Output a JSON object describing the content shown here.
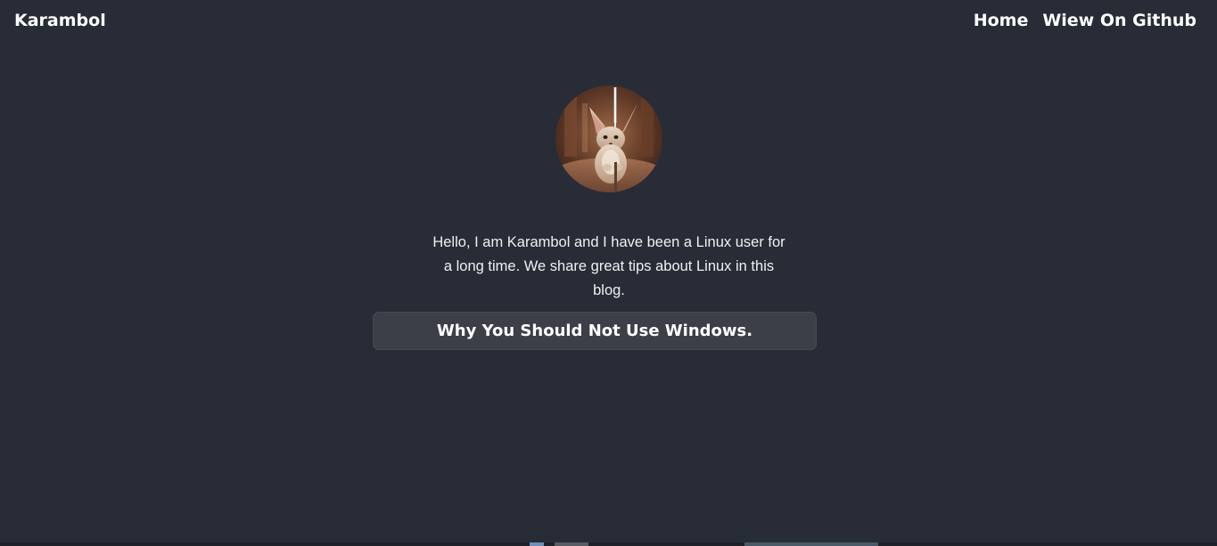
{
  "header": {
    "brand": "Karambol",
    "nav": [
      {
        "label": "Home"
      },
      {
        "label": "Wiew On Github"
      }
    ]
  },
  "profile": {
    "avatar_icon": "fennec-fox-avatar",
    "intro_text": "Hello, I am Karambol and I have been a Linux user for a long time. We share great tips about Linux in this blog."
  },
  "posts": [
    {
      "title": "Why You Should Not Use Windows."
    }
  ],
  "colors": {
    "background": "#282c36",
    "card": "#3c3f48",
    "text": "#ffffff"
  }
}
